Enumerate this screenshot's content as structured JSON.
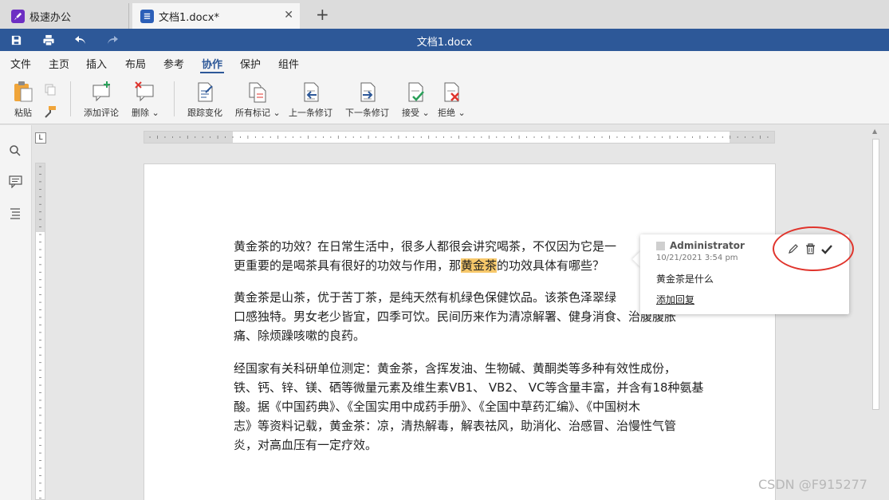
{
  "tabs": [
    {
      "label": "极速办公",
      "icon": "rocket-icon"
    },
    {
      "label": "文档1.docx*",
      "icon": "document-icon"
    }
  ],
  "titlebar": {
    "title": "文档1.docx"
  },
  "menu": [
    "文件",
    "主页",
    "插入",
    "布局",
    "参考",
    "协作",
    "保护",
    "组件"
  ],
  "menu_active": "协作",
  "ribbon": {
    "paste": "粘贴",
    "add_comment": "添加评论",
    "delete": "删除",
    "track_changes": "跟踪变化",
    "all_marks": "所有标记",
    "prev_change": "上一条修订",
    "next_change": "下一条修订",
    "accept": "接受",
    "reject": "拒绝"
  },
  "ruler": {
    "corner": "L"
  },
  "document": {
    "p1_before": "黄金茶的功效？在日常生活中，很多人都很会讲究喝茶，不仅因为它是一",
    "p1_line2_before": "更重要的是喝茶具有很好的功效与作用，那",
    "p1_highlight": "黄金茶",
    "p1_line2_after": "的功效具体有哪些？",
    "p2_line1": "黄金茶是山茶，优于苦丁茶，是纯天然有机绿色保健饮品。该茶色泽翠绿",
    "p2_line2": "口感独特。男女老少皆宜，四季可饮。民间历来作为清凉解署、健身消食、治腹腹胀",
    "p2_line3": "痛、除烦躁咳嗽的良药。",
    "p3_line1": "经国家有关科研单位测定：黄金茶，含挥发油、生物碱、黄酮类等多种有效性成份，",
    "p3_line2": "铁、钙、锌、镁、硒等微量元素及维生素VB1、 VB2、 VC等含量丰富，并含有18种氨基",
    "p3_line3": "酸。据《中国药典》、《全国实用中成药手册》、《全国中草药汇编》、《中国树木",
    "p3_line4": "志》等资料记载，黄金茶：凉，清热解毒，解表祛风，助消化、治感冒、治慢性气管",
    "p3_line5": "炎，对高血压有一定疗效。"
  },
  "comment": {
    "author": "Administrator",
    "time": "10/21/2021 3:54 pm",
    "text": "黄金茶是什么",
    "reply": "添加回复"
  },
  "watermark": "CSDN @F915277",
  "colors": {
    "brand": "#2d5898",
    "highlight": "#f7c86a",
    "annotation": "#e0342c"
  }
}
